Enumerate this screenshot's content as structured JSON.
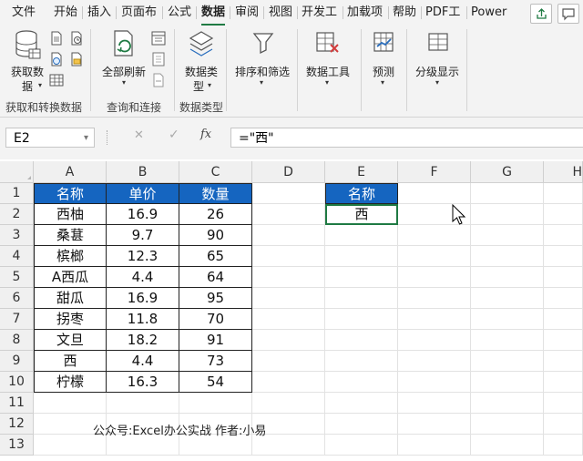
{
  "menu": {
    "tabs": [
      "文件",
      "开始",
      "插入",
      "页面布",
      "公式",
      "数据",
      "审阅",
      "视图",
      "开发工",
      "加载项",
      "帮助",
      "PDF工",
      "Power"
    ],
    "active": "数据"
  },
  "ribbon": {
    "get_data": {
      "line1": "获取数",
      "line2": "据"
    },
    "refresh_all": "全部刷新",
    "data_types": {
      "line1": "数据类",
      "line2": "型"
    },
    "sort_filter": "排序和筛选",
    "data_tools": "数据工具",
    "forecast": "预测",
    "outline": "分级显示",
    "groups": [
      "获取和转换数据",
      "查询和连接",
      "数据类型"
    ]
  },
  "formula_bar": {
    "name_box": "E2",
    "formula": "=\"西\"",
    "cancel_glyph": "✕",
    "enter_glyph": "✓",
    "fx_glyph": "fx"
  },
  "sheet": {
    "columns": [
      "A",
      "B",
      "C",
      "D",
      "E",
      "F",
      "G",
      "H"
    ],
    "rows": [
      "1",
      "2",
      "3",
      "4",
      "5",
      "6",
      "7",
      "8",
      "9",
      "10",
      "11",
      "12",
      "13"
    ],
    "table": {
      "headers": [
        "名称",
        "单价",
        "数量"
      ],
      "rows": [
        [
          "西柚",
          "16.9",
          "26"
        ],
        [
          "桑葚",
          "9.7",
          "90"
        ],
        [
          "槟榔",
          "12.3",
          "65"
        ],
        [
          "A西瓜",
          "4.4",
          "64"
        ],
        [
          "甜瓜",
          "16.9",
          "95"
        ],
        [
          "拐枣",
          "11.8",
          "70"
        ],
        [
          "文旦",
          "18.2",
          "91"
        ],
        [
          "西",
          "4.4",
          "73"
        ],
        [
          "柠檬",
          "16.3",
          "54"
        ]
      ]
    },
    "lookup": {
      "header": "名称",
      "value": "西"
    },
    "note": "公众号:Excel办公实战  作者:小易",
    "colors": {
      "header_fill": "#1565c0",
      "header_text": "#ffffff",
      "accent": "#1f7a43"
    }
  }
}
